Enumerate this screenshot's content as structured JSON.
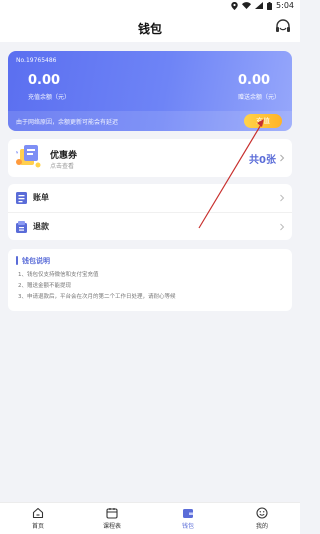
{
  "status_bar": {
    "time": "5:04"
  },
  "header": {
    "title": "钱包",
    "service_icon": "headset-icon"
  },
  "wallet": {
    "card_no": "No.19765486",
    "recharge_balance": "0.00",
    "recharge_balance_label": "充值余额（元）",
    "gift_balance": "0.00",
    "gift_balance_label": "赠送余额（元）",
    "note": "由于网络原因，余额更新可能会有延迟",
    "recharge_button": "充值"
  },
  "coupon": {
    "title": "优惠券",
    "subtitle": "点击查看",
    "count": "共0张"
  },
  "menu": [
    {
      "label": "账单",
      "icon": "bill-icon"
    },
    {
      "label": "退款",
      "icon": "refund-icon"
    }
  ],
  "explain": {
    "title": "钱包说明",
    "lines": [
      "1、钱包仅支持微信和支付宝充值",
      "2、赠送金额不能提现",
      "3、申请退款后，平台会在次月的第二个工作日处理，请耐心等候"
    ]
  },
  "tabs": [
    {
      "label": "首页",
      "icon": "home-icon"
    },
    {
      "label": "课程表",
      "icon": "calendar-icon"
    },
    {
      "label": "钱包",
      "icon": "wallet-icon",
      "active": true
    },
    {
      "label": "我的",
      "icon": "profile-icon"
    }
  ],
  "colors": {
    "accent": "#5a6cd8",
    "button": "#ffb327",
    "background": "#f2f3f7"
  }
}
